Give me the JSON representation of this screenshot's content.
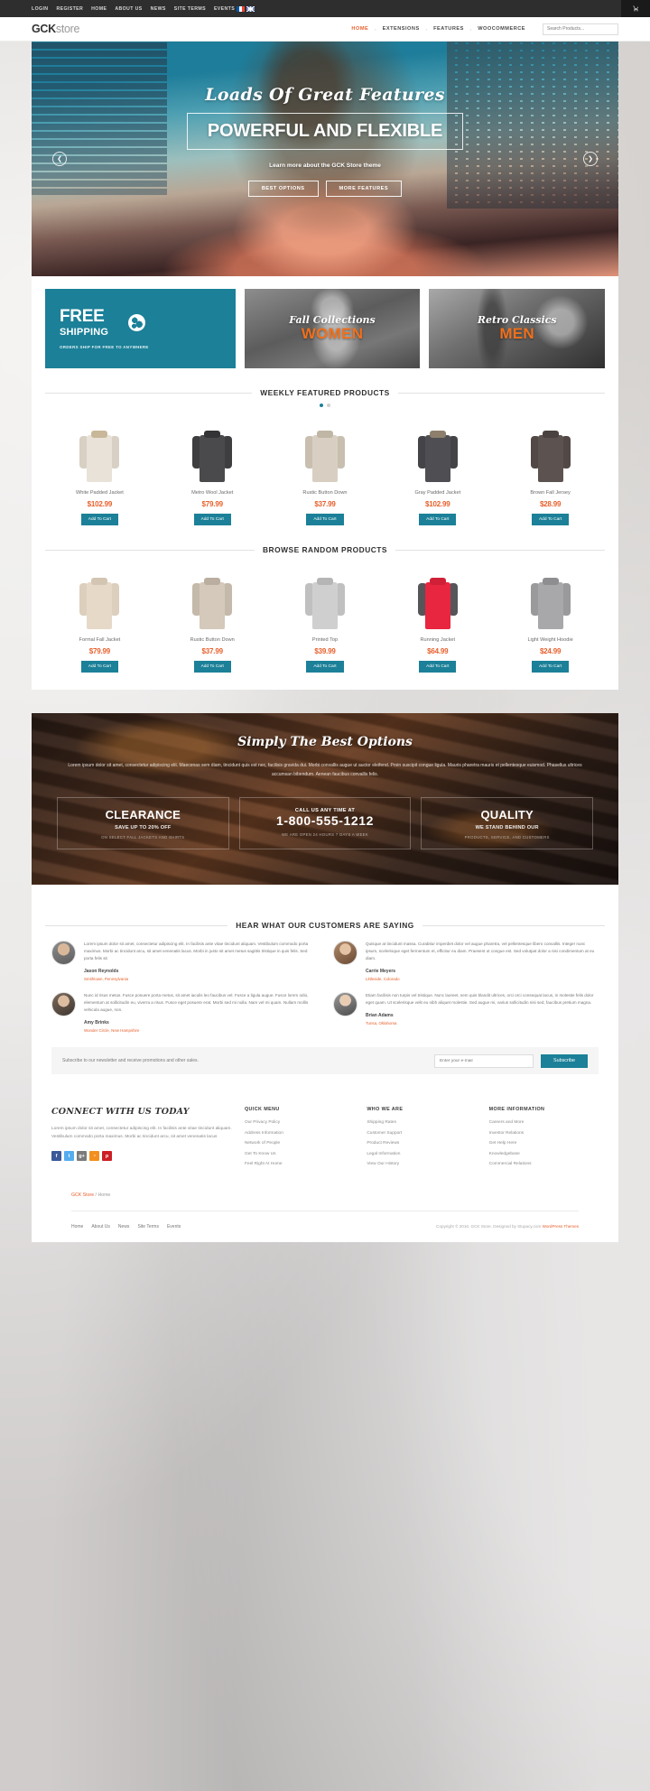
{
  "topbar": {
    "links": [
      "LOGIN",
      "REGISTER",
      "HOME",
      "ABOUT US",
      "NEWS",
      "SITE TERMS",
      "EVENTS"
    ],
    "flags": [
      "flag-france",
      "flag-uk"
    ],
    "cart_icon": "shopping-cart-icon"
  },
  "header": {
    "logo_bold": "GCK",
    "logo_light": "store",
    "nav": [
      {
        "label": "HOME",
        "active": true
      },
      {
        "label": "EXTENSIONS",
        "active": false
      },
      {
        "label": "FEATURES",
        "active": false
      },
      {
        "label": "WOOCOMMERCE",
        "active": false
      }
    ],
    "search_placeholder": "Search Products..."
  },
  "hero": {
    "script_title": "Loads Of Great Features",
    "title": "POWERFUL AND FLEXIBLE",
    "subtitle": "Learn more about the GCK Store theme",
    "buttons": [
      "BEST OPTIONS",
      "MORE FEATURES"
    ],
    "prev_icon": "chevron-left-icon",
    "next_icon": "chevron-right-icon"
  },
  "promos": [
    {
      "type": "free-shipping",
      "line1": "FREE",
      "line2": "SHIPPING",
      "note": "ORDERS SHIP FOR FREE TO ANYWHERE",
      "icon": "globe-icon",
      "bg": "#1b8098"
    },
    {
      "type": "photo",
      "script": "Fall Collections",
      "accent": "WOMEN",
      "accent_color": "#f0701c"
    },
    {
      "type": "photo",
      "script": "Retro Classics",
      "accent": "MEN",
      "accent_color": "#f0701c"
    }
  ],
  "featured": {
    "heading": "WEEKLY FEATURED PRODUCTS",
    "dots": 2,
    "active_dot": 0,
    "cart_label": "Add To Cart",
    "items": [
      {
        "name": "White Padded Jacket",
        "price": "$102.99",
        "color": "#e8e2d8",
        "sleeve": "#d8d0c4",
        "collar": "#c9b79a"
      },
      {
        "name": "Metro Wool Jacket",
        "price": "$79.99",
        "color": "#4a4a4c",
        "sleeve": "#3e3e40",
        "collar": "#343436"
      },
      {
        "name": "Rustic Button Down",
        "price": "$37.99",
        "color": "#d8cfc2",
        "sleeve": "#c8bfb0",
        "collar": "#bfb6a6"
      },
      {
        "name": "Gray Padded Jacket",
        "price": "$102.99",
        "color": "#4f4f53",
        "sleeve": "#444448",
        "collar": "#8d7f6c"
      },
      {
        "name": "Brown Fall Jersey",
        "price": "$28.99",
        "color": "#5c5250",
        "sleeve": "#524846",
        "collar": "#4a4240"
      }
    ]
  },
  "random": {
    "heading": "BROWSE RANDOM PRODUCTS",
    "cart_label": "Add To Cart",
    "items": [
      {
        "name": "Formal Fall Jacket",
        "price": "$79.99",
        "color": "#e6d9c8",
        "sleeve": "#dccfbd",
        "collar": "#d2c5b2"
      },
      {
        "name": "Rustic Button Down",
        "price": "$37.99",
        "color": "#d4c9ba",
        "sleeve": "#c4b9aa",
        "collar": "#b9ae9f"
      },
      {
        "name": "Printed Top",
        "price": "$39.99",
        "color": "#cfcfcf",
        "sleeve": "#c0c0c0",
        "collar": "#b5b5b5"
      },
      {
        "name": "Running Jacket",
        "price": "$64.99",
        "color": "#e8263f",
        "sleeve": "#55555a",
        "collar": "#cf2037"
      },
      {
        "name": "Light Weight Hoodie",
        "price": "$24.99",
        "color": "#a8a8ab",
        "sleeve": "#9a9a9d",
        "collar": "#8e8e91"
      }
    ]
  },
  "options": {
    "title": "Simply The Best Options",
    "paragraph": "Lorem ipsum dolor sit amet, consectetur adipiscing elit. Maecenas sem diam, tincidunt quis est nec, facilisis gravida dui. Morbi convallis augue ut auctor eleifend. Proin suscipit congue ligula. Mauris pharetra mauris et pellentesque euismod. Phasellus ultrices accumsan bibendum. Aenean faucibus convallis felis.",
    "cards": [
      {
        "head": "CLEARANCE",
        "sub": "SAVE UP TO 20% OFF",
        "tiny": "ON SELECT FALL JACKETS AND SHIRTS"
      },
      {
        "pre": "CALL US ANY TIME AT",
        "head": "1-800-555-1212",
        "tiny": "WE ARE OPEN 24 HOURS 7 DAYS A WEEK"
      },
      {
        "head": "QUALITY",
        "sub": "WE STAND BEHIND OUR",
        "tiny": "PRODUCTS, SERVICE, AND CUSTOMERS"
      }
    ]
  },
  "testimonials": {
    "heading": "HEAR WHAT OUR CUSTOMERS ARE SAYING",
    "items": [
      {
        "text": "Lorem ipsum dolor sit amet, consectetur adipiscing elit. In facilisis ante vitae tincidunt aliquam. Vestibulum commodo porta maximus. Morbi ac tincidunt arcu, sit amet venenatis lacus. Morbi in justo sit amet metus sagittis tristique in quis felis. Sed porta felis sit",
        "name": "Jason Reynolds",
        "location": "Smithtown, Pennsylvania"
      },
      {
        "text": "Quisque at tincidunt massa. Curabitur imperdiet dolor vel augue pharetra, vel pellentesque libero convallis. Integer nunc ipsum, scelerisque eget fermentum et, efficitur eu diam. Praesent ut congue est. Sed volutpat dolor a nisi condimentum at eu diam.",
        "name": "Carrie Meyers",
        "location": "Littleside, Colorado"
      },
      {
        "text": "Nunc id risus metus. Fusce posuere porta metus, sit amet iaculis leo faucibus vel. Fusce a ligula augue. Fusce lorem odio, elementum at sollicitudin eu, viverra a risus. Fusce eget posuere erat. Morbi sed mi nulla. Nam vel mi quam. Nullam mollis vehicula augue, non.",
        "name": "Amy Brinks",
        "location": "Wonder Circle, New Hampshire"
      },
      {
        "text": "Etiam facilisis non turpis vel tristique. Nunc laoreet, sem quis blandit ultrices, orci orci consequat lacus, in molestie felis dolor eget quam. Ut scelerisque velit eu nibh aliquet molestie. Sed augue mi, varius sollicitudin nisi sed, faucibus pretium magna.",
        "name": "Brian Adams",
        "location": "Tunsa, Oklahoma"
      }
    ]
  },
  "newsletter": {
    "label": "Subscribe to our newsletter and receive promotions and other sales.",
    "input_placeholder": "Enter your e-mail",
    "button": "Subscribe"
  },
  "footer": {
    "about_title": "CONNECT WITH US TODAY",
    "about_text": "Lorem ipsum dolor sit amet, consectetur adipiscing elit. In facilisis ante vitae tincidunt aliquam. Vestibulum commodo porta maximus. Morbi ac tincidunt arcu, sit amet venenatis lacus",
    "socials": [
      {
        "name": "facebook-icon",
        "glyph": "f",
        "color": "#3b5998"
      },
      {
        "name": "twitter-icon",
        "glyph": "t",
        "color": "#55acee"
      },
      {
        "name": "google-plus-icon",
        "glyph": "g+",
        "color": "#7b7b7b"
      },
      {
        "name": "rss-icon",
        "glyph": "◔",
        "color": "#f3901d"
      },
      {
        "name": "pinterest-icon",
        "glyph": "p",
        "color": "#cb2027"
      }
    ],
    "columns": [
      {
        "head": "QUICK MENU",
        "items": [
          "Our Privacy Policy",
          "Address Information",
          "Network of People",
          "Get To Know Us",
          "Feel Right At Home"
        ]
      },
      {
        "head": "WHO WE ARE",
        "items": [
          "Shipping Rates",
          "Customer Support",
          "Product Reviews",
          "Legal Information",
          "View Our History"
        ]
      },
      {
        "head": "MORE INFORMATION",
        "items": [
          "Careers and More",
          "Investor Relations",
          "Get Help Here",
          "Knowledgebase",
          "Commercial Relations"
        ]
      }
    ],
    "breadcrumb_root": "GCK Store",
    "breadcrumb_sep": "/",
    "breadcrumb_current": "Home",
    "bottom_links": [
      "Home",
      "About Us",
      "News",
      "Site Terms",
      "Events"
    ],
    "copyright_pre": "Copyright © 2016. GCK Store. Designed by Stupacy.com ",
    "copyright_link": "WordPress Themes"
  }
}
